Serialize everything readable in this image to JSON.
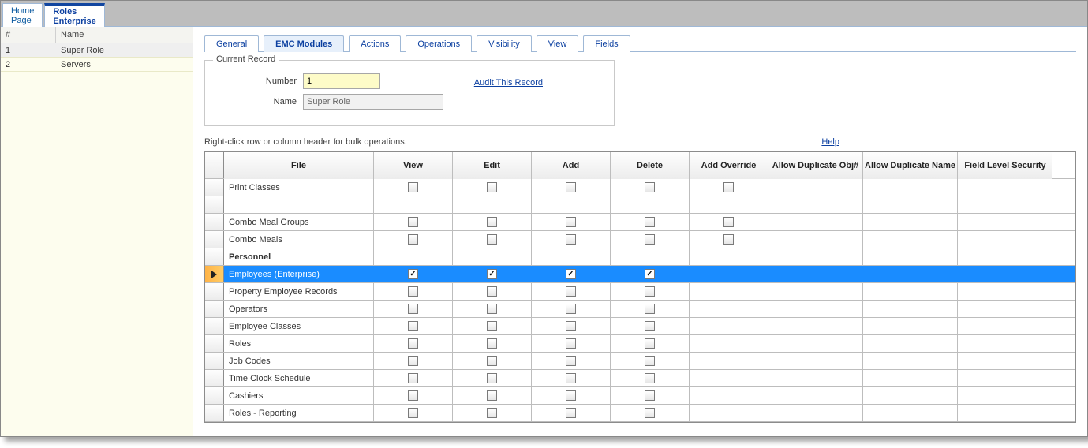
{
  "top_tabs": {
    "home": "Home\nPage",
    "roles": "Roles\nEnterprise"
  },
  "left": {
    "col_num": "#",
    "col_name": "Name",
    "rows": [
      {
        "n": "1",
        "name": "Super Role",
        "sel": true
      },
      {
        "n": "2",
        "name": "Servers",
        "sel": false
      }
    ]
  },
  "mid_tabs": {
    "general": "General",
    "emc": "EMC Modules",
    "actions": "Actions",
    "operations": "Operations",
    "visibility": "Visibility",
    "view": "View",
    "fields": "Fields"
  },
  "record": {
    "legend": "Current Record",
    "number_label": "Number",
    "number_value": "1",
    "name_label": "Name",
    "name_value": "Super Role",
    "audit": "Audit This Record"
  },
  "hint": "Right-click row or column header for bulk operations.",
  "help": "Help",
  "grid": {
    "headers": {
      "file": "File",
      "view": "View",
      "edit": "Edit",
      "add": "Add",
      "delete": "Delete",
      "add_override": "Add Override",
      "allow_dup_obj": "Allow Duplicate Obj#",
      "allow_dup_name": "Allow Duplicate Name",
      "field_level": "Field Level Security"
    },
    "rows": [
      {
        "file": "Print Classes",
        "view": false,
        "edit": false,
        "add": false,
        "delete": false,
        "ao": false
      },
      {
        "file": "",
        "spacer": true
      },
      {
        "file": "Combo Meal Groups",
        "view": false,
        "edit": false,
        "add": false,
        "delete": false,
        "ao": false
      },
      {
        "file": "Combo Meals",
        "view": false,
        "edit": false,
        "add": false,
        "delete": false,
        "ao": false
      },
      {
        "file": "Personnel",
        "section": true
      },
      {
        "file": "Employees (Enterprise)",
        "selected": true,
        "view": true,
        "edit": true,
        "add": true,
        "delete": true
      },
      {
        "file": "Property Employee Records",
        "view": false,
        "edit": false,
        "add": false,
        "delete": false
      },
      {
        "file": "Operators",
        "view": false,
        "edit": false,
        "add": false,
        "delete": false
      },
      {
        "file": "Employee Classes",
        "view": false,
        "edit": false,
        "add": false,
        "delete": false
      },
      {
        "file": "Roles",
        "view": false,
        "edit": false,
        "add": false,
        "delete": false
      },
      {
        "file": "Job Codes",
        "view": false,
        "edit": false,
        "add": false,
        "delete": false
      },
      {
        "file": "Time Clock Schedule",
        "view": false,
        "edit": false,
        "add": false,
        "delete": false
      },
      {
        "file": "Cashiers",
        "view": false,
        "edit": false,
        "add": false,
        "delete": false
      },
      {
        "file": "Roles - Reporting",
        "view": false,
        "edit": false,
        "add": false,
        "delete": false
      }
    ]
  }
}
